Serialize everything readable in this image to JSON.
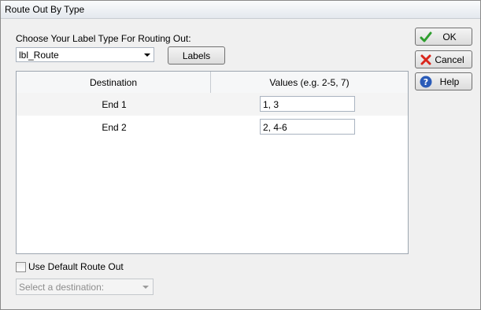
{
  "window": {
    "title": "Route Out By Type"
  },
  "label_type": {
    "prompt": "Choose Your Label Type For Routing Out:",
    "selected": "lbl_Route",
    "labels_button": "Labels"
  },
  "grid": {
    "headers": [
      "Destination",
      "Values (e.g. 2-5, 7)"
    ],
    "rows": [
      {
        "destination": "End 1",
        "value": "1, 3"
      },
      {
        "destination": "End 2",
        "value": "2, 4-6"
      }
    ]
  },
  "buttons": {
    "ok": "OK",
    "cancel": "Cancel",
    "help": "Help"
  },
  "default_route": {
    "checkbox_label": "Use Default Route Out",
    "checked": false,
    "destination_placeholder": "Select a destination:"
  },
  "icons": {
    "ok": "checkmark-icon",
    "cancel": "red-x-icon",
    "help": "help-question-icon"
  },
  "colors": {
    "ok_icon": "#2e9e2e",
    "cancel_icon": "#d9261c",
    "help_icon": "#2a5bb8"
  }
}
